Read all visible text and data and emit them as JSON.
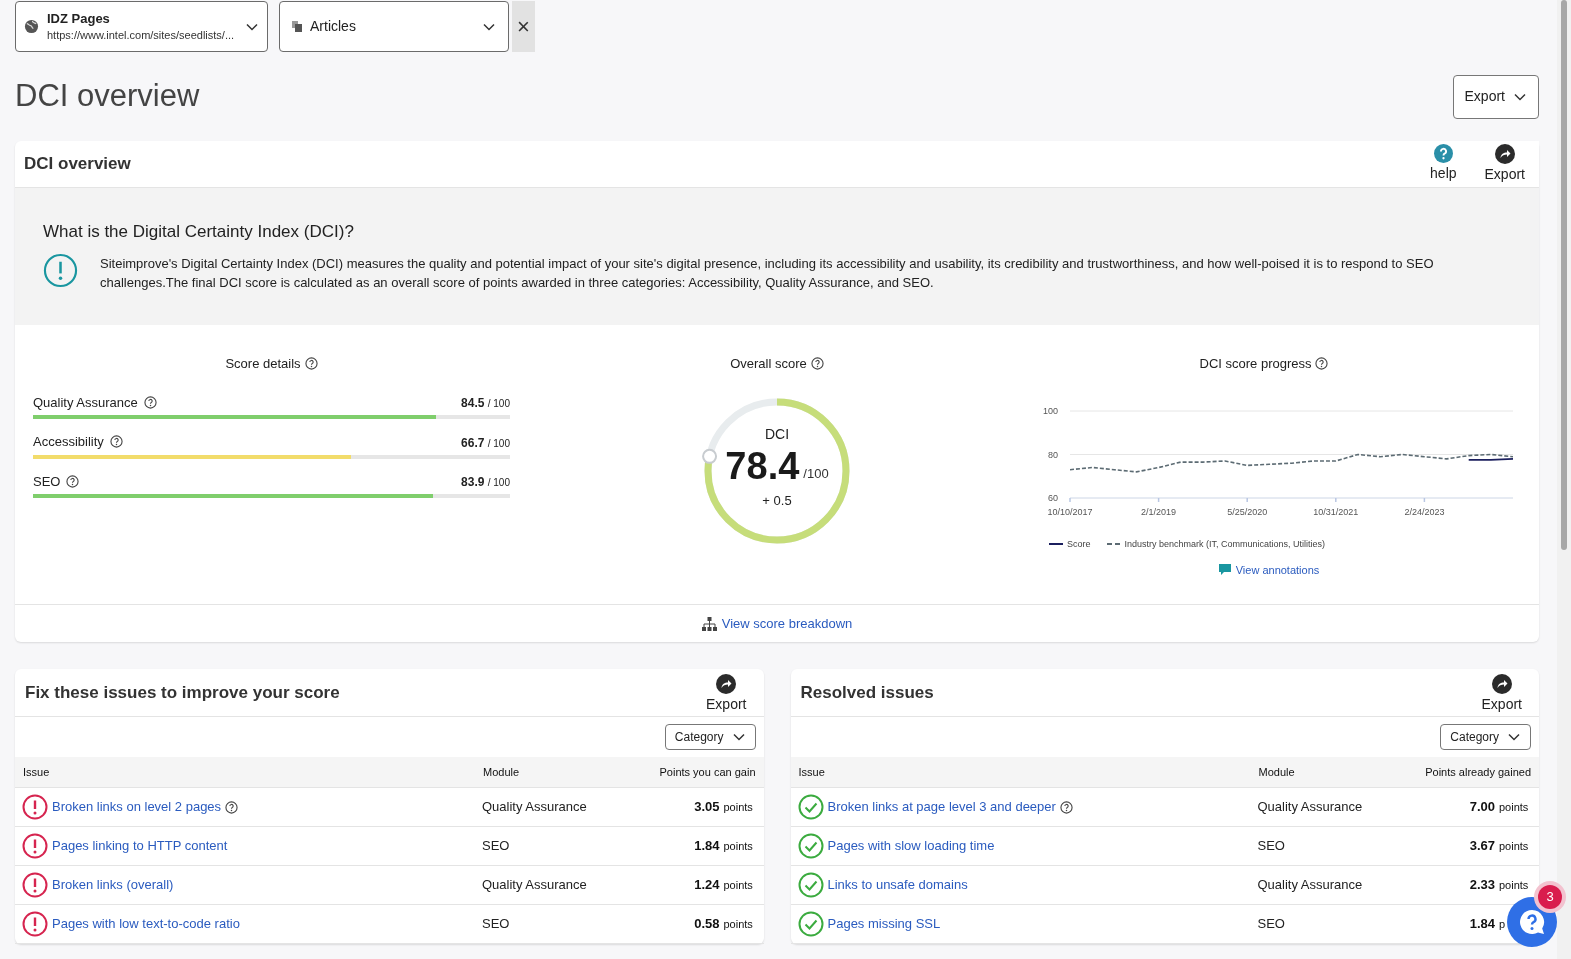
{
  "selectors": [
    {
      "kind": "site",
      "title": "IDZ Pages",
      "subtitle": "https://www.intel.com/sites/seedlists/..."
    },
    {
      "kind": "group",
      "title": "Articles"
    }
  ],
  "clear_button": "×",
  "page_title": "DCI overview",
  "export_button": "Export",
  "overview_card": {
    "title": "DCI overview",
    "actions": [
      {
        "kind": "help",
        "label": "help"
      },
      {
        "kind": "export",
        "label": "Export"
      }
    ],
    "info_heading": "What is the Digital Certainty Index (DCI)?",
    "info_text": "Siteimprove's Digital Certainty Index (DCI) measures the quality and potential impact of your site's digital presence, including its accessibility and usability, its credibility and trustworthiness, and how well-poised it is to respond to SEO challenges.The final DCI score is calculated as an overall score of points awarded in three categories: Accessibility, Quality Assurance, and SEO.",
    "score_details": {
      "title": "Score details",
      "items": [
        {
          "name": "Quality Assurance",
          "score": "84.5",
          "max": "/ 100",
          "level": 0.845,
          "color": "#7fce6c"
        },
        {
          "name": "Accessibility",
          "score": "66.7",
          "max": "/ 100",
          "level": 0.667,
          "color": "#f2dc6b"
        },
        {
          "name": "SEO",
          "score": "83.9",
          "max": "/ 100",
          "level": 0.839,
          "color": "#7fce6c"
        }
      ]
    },
    "overall": {
      "title": "Overall score",
      "label": "DCI",
      "score": "78.4",
      "max": "/100",
      "change": "+ 0.5",
      "level": 0.784
    },
    "progress": {
      "title": "DCI score progress",
      "link": "View annotations",
      "chart_data": {
        "type": "line",
        "categories": [
          "10/10/2017",
          null,
          null,
          null,
          "2/1/2019",
          null,
          null,
          null,
          "5/25/2020",
          null,
          null,
          null,
          "10/31/2021",
          null,
          null,
          null,
          "2/24/2023",
          null,
          null,
          null,
          null
        ],
        "ylim": [
          60,
          100
        ],
        "yticks": [
          60,
          80,
          100
        ],
        "legend": "bottom",
        "series": [
          {
            "name": "Score",
            "color": "#1b1f5e",
            "line_style": "solid",
            "values": [
              null,
              null,
              null,
              null,
              null,
              null,
              null,
              null,
              null,
              null,
              null,
              null,
              null,
              null,
              null,
              null,
              null,
              null,
              77.5,
              77.5,
              78
            ]
          },
          {
            "name": "Industry benchmark (IT, Communications, Utilities)",
            "color": "#5c6b73",
            "line_style": "dashed",
            "values": [
              73,
              74,
              73,
              72,
              74,
              76.5,
              76.5,
              77,
              75,
              75.5,
              76,
              77,
              77,
              80,
              79,
              80,
              79,
              78,
              79.5,
              80,
              79
            ]
          }
        ]
      }
    },
    "breakdown_link": "View score breakdown"
  },
  "tables": [
    {
      "title": "Fix these issues to improve your score",
      "export": "Export",
      "filter": "Category",
      "columns": [
        "Issue",
        "Module",
        "Points you can gain"
      ],
      "rows": [
        {
          "kind": "open",
          "issue": "Broken links on level 2 pages",
          "help": true,
          "module": "Quality Assurance",
          "points": "3.05",
          "unit": "points"
        },
        {
          "kind": "open",
          "issue": "Pages linking to HTTP content",
          "help": false,
          "module": "SEO",
          "points": "1.84",
          "unit": "points"
        },
        {
          "kind": "open",
          "issue": "Broken links (overall)",
          "help": false,
          "module": "Quality Assurance",
          "points": "1.24",
          "unit": "points"
        },
        {
          "kind": "open",
          "issue": "Pages with low text-to-code ratio",
          "help": false,
          "module": "SEO",
          "points": "0.58",
          "unit": "points"
        }
      ]
    },
    {
      "title": "Resolved issues",
      "export": "Export",
      "filter": "Category",
      "columns": [
        "Issue",
        "Module",
        "Points already gained"
      ],
      "rows": [
        {
          "kind": "resolved",
          "issue": "Broken links at page level 3 and deeper",
          "help": true,
          "module": "Quality Assurance",
          "points": "7.00",
          "unit": "points"
        },
        {
          "kind": "resolved",
          "issue": "Pages with slow loading time",
          "help": false,
          "module": "SEO",
          "points": "3.67",
          "unit": "points"
        },
        {
          "kind": "resolved",
          "issue": "Links to unsafe domains",
          "help": false,
          "module": "Quality Assurance",
          "points": "2.33",
          "unit": "points"
        },
        {
          "kind": "resolved",
          "issue": "Pages missing SSL",
          "help": false,
          "module": "SEO",
          "points": "1.84",
          "unit": "p"
        }
      ]
    }
  ],
  "help_widget": {
    "badge": "3"
  }
}
